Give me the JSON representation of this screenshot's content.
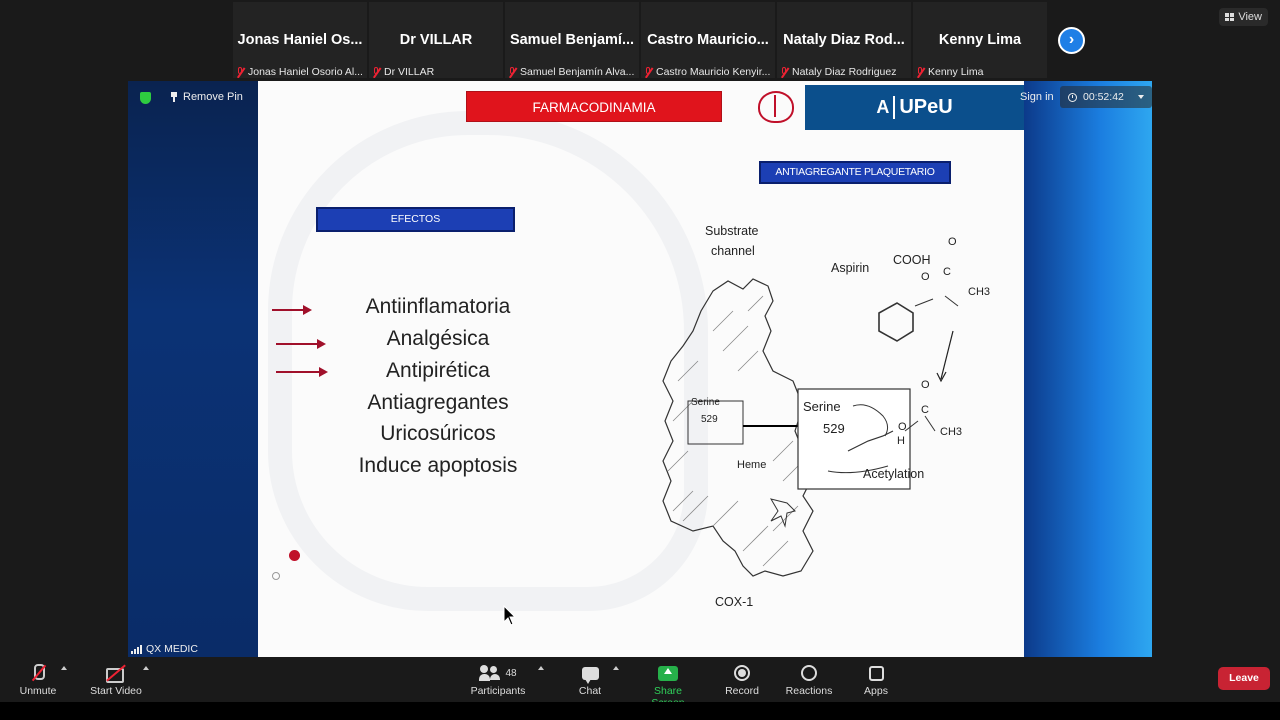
{
  "top": {
    "view_label": "View"
  },
  "participants_strip": [
    {
      "display_name": "Jonas  Haniel  Os...",
      "full_name": "Jonas Haniel Osorio Al..."
    },
    {
      "display_name": "Dr VILLAR",
      "full_name": "Dr VILLAR"
    },
    {
      "display_name": "Samuel  Benjamí...",
      "full_name": "Samuel Benjamín Alva..."
    },
    {
      "display_name": "Castro  Mauricio...",
      "full_name": "Castro Mauricio Kenyir..."
    },
    {
      "display_name": "Nataly  Diaz  Rod...",
      "full_name": "Nataly Diaz Rodriguez"
    },
    {
      "display_name": "Kenny Lima",
      "full_name": "Kenny Lima"
    }
  ],
  "share_header": {
    "remove_pin": "Remove Pin",
    "sign_in": "Sign in",
    "timer": "00:52:42"
  },
  "host_label": "QX MEDIC",
  "slide": {
    "title": "FARMACODINAMIA",
    "logo_mark": "A",
    "logo_text": "UPeU",
    "subtitle": "ANTIAGREGANTE PLAQUETARIO",
    "section": "EFECTOS",
    "effects": [
      "Antiinflamatoria",
      "Analgésica",
      "Antipirética",
      "Antiagregantes",
      "Uricosúricos",
      "Induce apoptosis"
    ],
    "diagram": {
      "substrate": "Substrate",
      "channel": "channel",
      "aspirin": "Aspirin",
      "cooh": "COOH",
      "o1": "O",
      "o2": "O",
      "c1": "C",
      "ch3": "CH3",
      "serine_small": "Serine",
      "n529_small": "529",
      "serine_big": "Serine",
      "n529_big": "529",
      "o3": "O",
      "h": "H",
      "c2": "C",
      "ch3b": "CH3",
      "o4": "O",
      "heme": "Heme",
      "acetylation": "Acetylation",
      "cox": "COX-1"
    }
  },
  "toolbar": {
    "unmute": "Unmute",
    "start_video": "Start Video",
    "participants": "Participants",
    "participants_count": "48",
    "chat": "Chat",
    "share_screen": "Share Screen",
    "record": "Record",
    "reactions": "Reactions",
    "apps": "Apps",
    "leave": "Leave"
  }
}
